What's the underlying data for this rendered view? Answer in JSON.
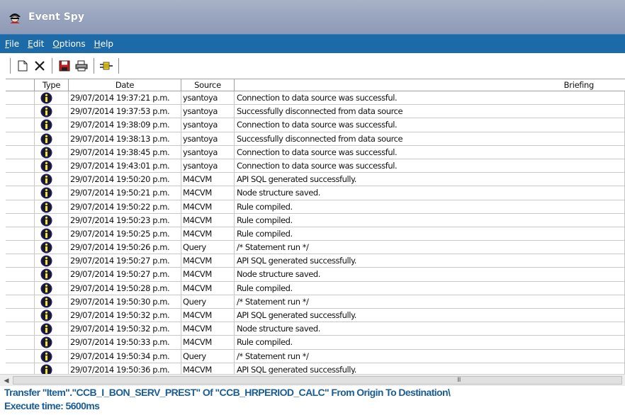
{
  "window": {
    "title": "Event Spy"
  },
  "menu": [
    {
      "label": "File",
      "ul": "F",
      "rest": "ile"
    },
    {
      "label": "Edit",
      "ul": "E",
      "rest": "dit"
    },
    {
      "label": "Options",
      "ul": "O",
      "rest": "ptions"
    },
    {
      "label": "Help",
      "ul": "H",
      "rest": "elp"
    }
  ],
  "toolbar": {
    "buttons": [
      "new-icon",
      "delete-icon",
      "save-icon",
      "print-icon",
      "connector-icon"
    ]
  },
  "columns": {
    "type": "Type",
    "date": "Date",
    "source": "Source",
    "briefing": "Briefing"
  },
  "rows": [
    {
      "icon": "info-icon",
      "date": "29/07/2014 19:37:21 p.m.",
      "source": "ysantoya",
      "briefing": "Connection to data source was successful."
    },
    {
      "icon": "info-icon",
      "date": "29/07/2014 19:37:53 p.m.",
      "source": "ysantoya",
      "briefing": "Successfully disconnected from data source"
    },
    {
      "icon": "info-icon",
      "date": "29/07/2014 19:38:09 p.m.",
      "source": "ysantoya",
      "briefing": "Connection to data source was successful."
    },
    {
      "icon": "info-icon",
      "date": "29/07/2014 19:38:13 p.m.",
      "source": "ysantoya",
      "briefing": "Successfully disconnected from data source"
    },
    {
      "icon": "info-icon",
      "date": "29/07/2014 19:38:45 p.m.",
      "source": "ysantoya",
      "briefing": "Connection to data source was successful."
    },
    {
      "icon": "info-icon",
      "date": "29/07/2014 19:43:01 p.m.",
      "source": "ysantoya",
      "briefing": "Connection to data source was successful."
    },
    {
      "icon": "info-icon",
      "date": "29/07/2014 19:50:20 p.m.",
      "source": "M4CVM",
      "briefing": "API SQL generated successfully."
    },
    {
      "icon": "info-icon",
      "date": "29/07/2014 19:50:21 p.m.",
      "source": "M4CVM",
      "briefing": "Node structure saved."
    },
    {
      "icon": "info-icon",
      "date": "29/07/2014 19:50:22 p.m.",
      "source": "M4CVM",
      "briefing": "Rule compiled."
    },
    {
      "icon": "info-icon",
      "date": "29/07/2014 19:50:23 p.m.",
      "source": "M4CVM",
      "briefing": "Rule compiled."
    },
    {
      "icon": "info-icon",
      "date": "29/07/2014 19:50:25 p.m.",
      "source": "M4CVM",
      "briefing": "Rule compiled."
    },
    {
      "icon": "info-icon",
      "date": "29/07/2014 19:50:26 p.m.",
      "source": "Query",
      "briefing": "/* Statement run */"
    },
    {
      "icon": "info-icon",
      "date": "29/07/2014 19:50:27 p.m.",
      "source": "M4CVM",
      "briefing": "API SQL generated successfully."
    },
    {
      "icon": "info-icon",
      "date": "29/07/2014 19:50:27 p.m.",
      "source": "M4CVM",
      "briefing": "Node structure saved."
    },
    {
      "icon": "info-icon",
      "date": "29/07/2014 19:50:28 p.m.",
      "source": "M4CVM",
      "briefing": "Rule compiled."
    },
    {
      "icon": "info-icon",
      "date": "29/07/2014 19:50:30 p.m.",
      "source": "Query",
      "briefing": "/* Statement run */"
    },
    {
      "icon": "info-icon",
      "date": "29/07/2014 19:50:32 p.m.",
      "source": "M4CVM",
      "briefing": "API SQL generated successfully."
    },
    {
      "icon": "info-icon",
      "date": "29/07/2014 19:50:32 p.m.",
      "source": "M4CVM",
      "briefing": "Node structure saved."
    },
    {
      "icon": "info-icon",
      "date": "29/07/2014 19:50:33 p.m.",
      "source": "M4CVM",
      "briefing": "Rule compiled."
    },
    {
      "icon": "info-icon",
      "date": "29/07/2014 19:50:34 p.m.",
      "source": "Query",
      "briefing": "/* Statement run */"
    },
    {
      "icon": "info-icon",
      "date": "29/07/2014 19:50:36 p.m.",
      "source": "M4CVM",
      "briefing": "API SQL generated successfully."
    }
  ],
  "scrollbar": {
    "grip": "III"
  },
  "status": {
    "line1": "Transfer  \"Item\".\"CCB_I_BON_SERV_PREST\" Of \"CCB_HRPERIOD_CALC\" From Origin To Destination\\",
    "line2": "Execute time: 5600ms"
  },
  "colors": {
    "menubar": "#1d6aa8",
    "status_text": "#1a5d95",
    "info_icon": "#1c1c8c"
  }
}
